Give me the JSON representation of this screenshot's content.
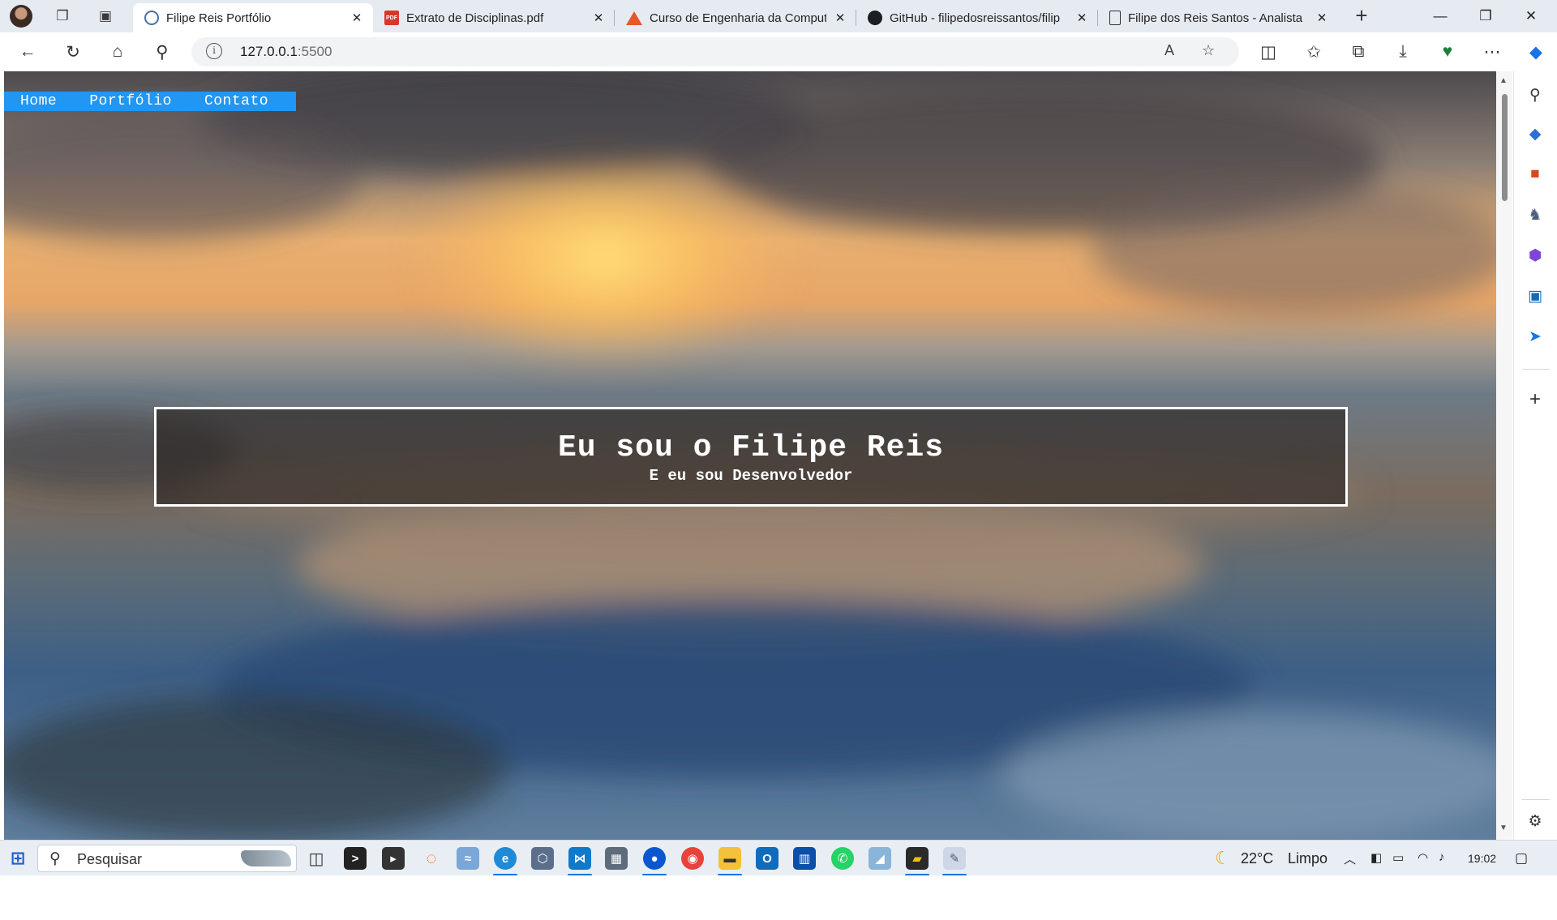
{
  "browser": {
    "tabs": [
      {
        "title": "Filipe Reis Portfólio",
        "favicon": "globe-icon",
        "active": true
      },
      {
        "title": "Extrato de Disciplinas.pdf",
        "favicon": "pdf-icon",
        "active": false
      },
      {
        "title": "Curso de Engenharia da Comput",
        "favicon": "triangle-logo-icon",
        "active": false
      },
      {
        "title": "GitHub - filipedosreissantos/filip",
        "favicon": "github-icon",
        "active": false
      },
      {
        "title": "Filipe dos Reis Santos - Analista",
        "favicon": "document-icon",
        "active": false
      }
    ],
    "close_glyph": "✕",
    "new_tab_glyph": "+",
    "window_controls": {
      "minimize": "—",
      "maximize": "❐",
      "close": "✕"
    },
    "address": {
      "host": "127.0.0.1",
      "port": ":5500",
      "info_glyph": "i"
    }
  },
  "page": {
    "nav_links": [
      "Home",
      "Portfólio",
      "Contato"
    ],
    "hero_title": "Eu sou o Filipe Reis",
    "hero_subtitle": "E eu sou Desenvolvedor",
    "nav_color": "#2196f3"
  },
  "taskbar": {
    "search_placeholder": "Pesquisar",
    "weather_temp": "22°C",
    "weather_desc": "Limpo",
    "time": "19:02"
  }
}
